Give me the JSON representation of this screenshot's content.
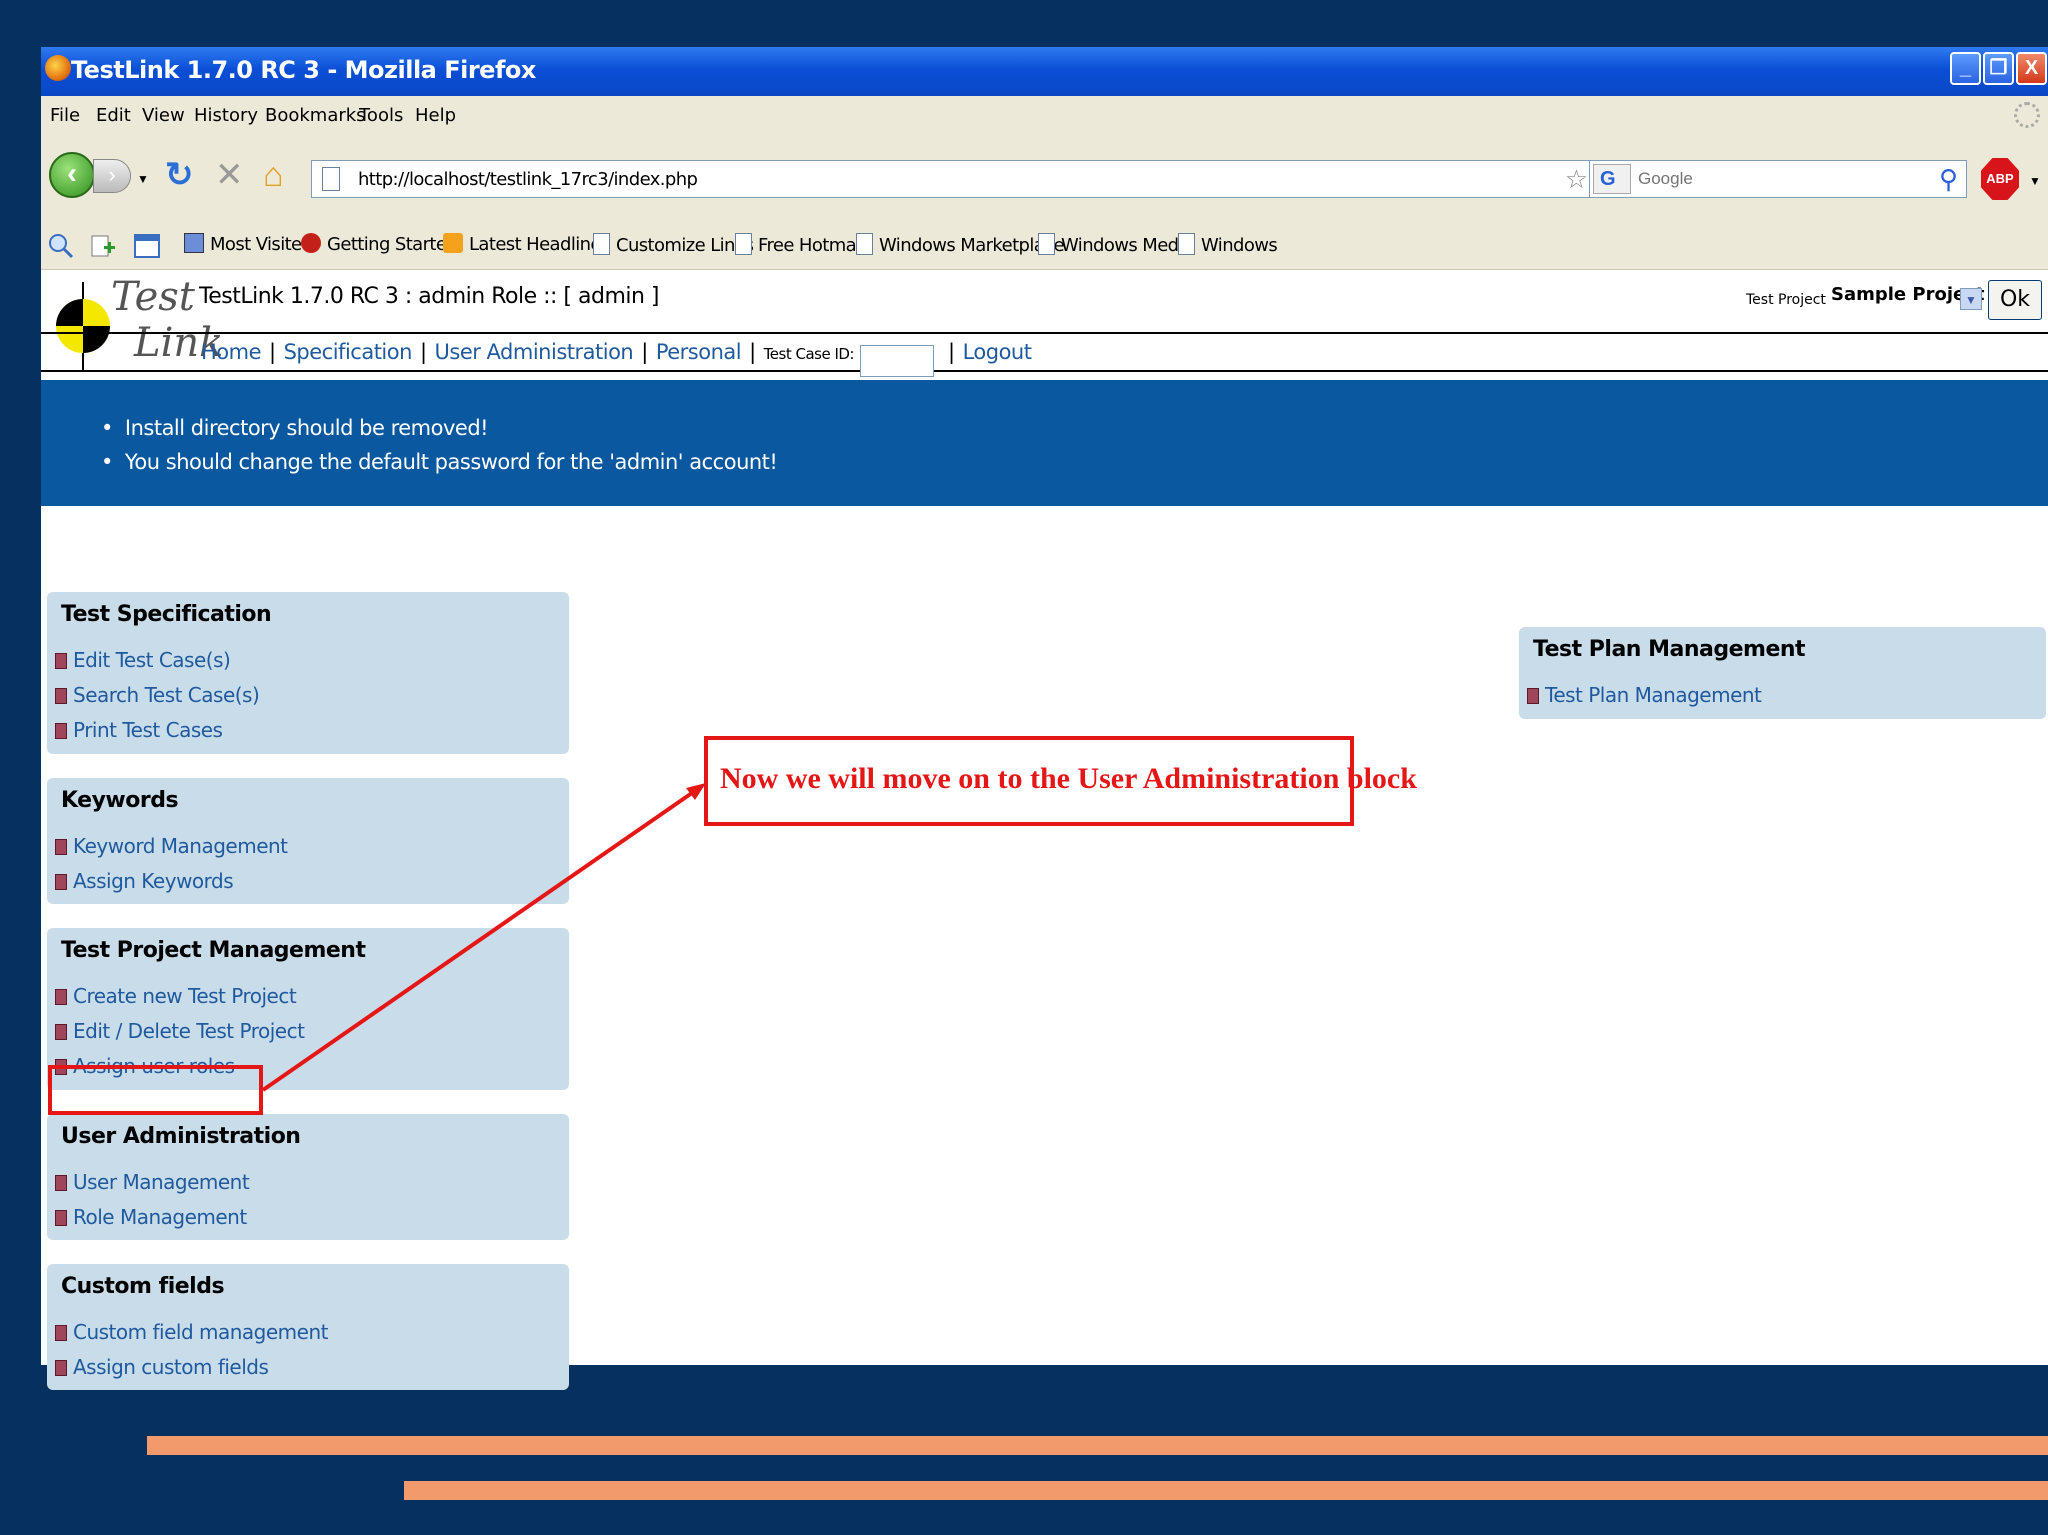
{
  "window": {
    "title": "TestLink 1.7.0 RC 3 - Mozilla Firefox",
    "controls": [
      "_",
      "❐",
      "X"
    ]
  },
  "menubar": [
    "File",
    "Edit",
    "View",
    "History",
    "Bookmarks",
    "Tools",
    "Help"
  ],
  "navbar": {
    "url": "http://localhost/testlink_17rc3/index.php",
    "search_placeholder": "Google",
    "adblock_label": "ABP"
  },
  "bookmarks": [
    "Most Visited",
    "Getting Started",
    "Latest Headlines",
    "Customize Links",
    "Free Hotmail",
    "Windows Marketplace",
    "Windows Media",
    "Windows"
  ],
  "testlink": {
    "logo_test": "Test",
    "logo_link": "Link",
    "title": "TestLink 1.7.0 RC 3 : admin Role :: [ admin ]",
    "project_label": "Test Project",
    "project_value": "Sample Project",
    "ok_label": "Ok",
    "nav": [
      "Home",
      "Specification",
      "User Administration",
      "Personal"
    ],
    "testcase_id_label": "Test Case ID:",
    "logout": "Logout",
    "warnings": [
      "Install directory should be removed!",
      "You should change the default password for the 'admin' account!"
    ],
    "blocks": [
      {
        "heading": "Test Specification",
        "links": [
          "Edit Test Case(s)",
          "Search Test Case(s)",
          "Print Test Cases"
        ]
      },
      {
        "heading": "Keywords",
        "links": [
          "Keyword Management",
          "Assign Keywords"
        ]
      },
      {
        "heading": "Test Project Management",
        "links": [
          "Create new Test Project",
          "Edit / Delete Test Project",
          "Assign user roles"
        ]
      },
      {
        "heading": "User Administration",
        "links": [
          "User Management",
          "Role Management"
        ]
      },
      {
        "heading": "Custom fields",
        "links": [
          "Custom field management",
          "Assign custom fields"
        ]
      }
    ],
    "right_block": {
      "heading": "Test Plan Management",
      "links": [
        "Test Plan Management"
      ]
    }
  },
  "annotation": {
    "callout_text": "Now we will move on to the User Administration block",
    "color": "#e51616"
  },
  "colors": {
    "slide_bg": "#06305f",
    "stripe": "#f29a6b",
    "block_bg": "#c9dce9",
    "warning_bg": "#0a589f",
    "link": "#1f5a9e"
  }
}
